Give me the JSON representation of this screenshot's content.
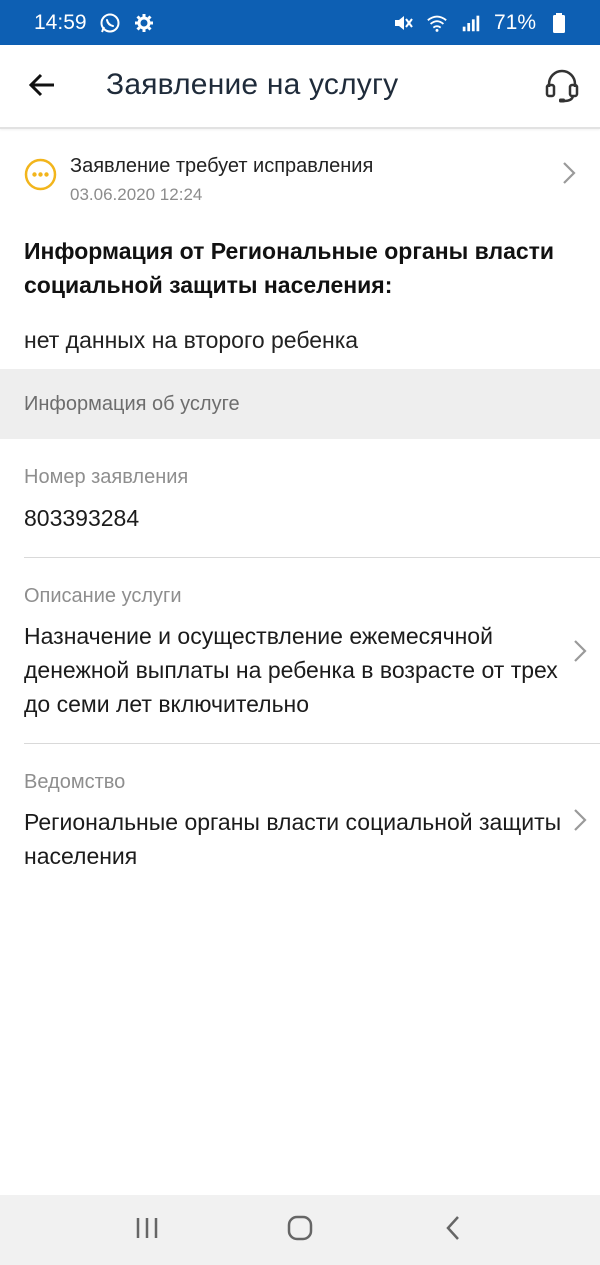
{
  "status_bar": {
    "time": "14:59",
    "battery": "71%",
    "icons": [
      "whatsapp-icon",
      "gear-icon",
      "mute-icon",
      "wifi-icon",
      "signal-icon",
      "battery-icon"
    ]
  },
  "app_bar": {
    "title": "Заявление на услугу",
    "back_icon": "arrow-left-icon",
    "support_icon": "headset-icon"
  },
  "application_status": {
    "title": "Заявление требует исправления",
    "date": "03.06.2020 12:24",
    "icon": "ellipsis-circle-icon",
    "accent_color": "#f2b51c"
  },
  "agency_info": {
    "heading": "Информация от Региональные органы власти социальной защиты населения:",
    "text": "нет данных на второго ребенка"
  },
  "service_section": {
    "title": "Информация об услуге"
  },
  "fields": {
    "number": {
      "label": "Номер заявления",
      "value": "803393284"
    },
    "description": {
      "label": "Описание услуги",
      "value": "Назначение и осуществление ежемесячной денежной выплаты на ребенка в возрасте от трех до семи лет включительно"
    },
    "department": {
      "label": "Ведомство",
      "value": "Региональные органы власти социальной защиты населения"
    }
  },
  "nav_bar": {
    "recent_icon": "recent-apps-icon",
    "home_icon": "home-icon",
    "back_icon": "back-chevron-icon"
  },
  "colors": {
    "status_bar": "#0d5fb3",
    "nav_bar": "#f1f1f1",
    "section_band": "#eeeeee"
  }
}
